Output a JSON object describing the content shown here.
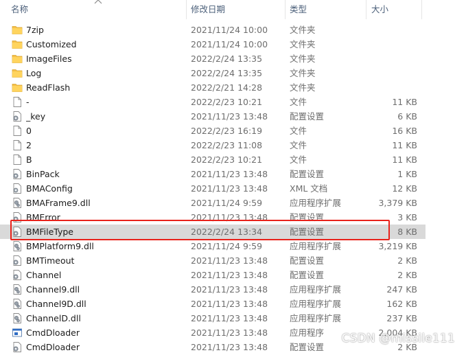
{
  "header": {
    "name": "名称",
    "date": "修改日期",
    "type": "类型",
    "size": "大小"
  },
  "files": [
    {
      "name": "7zip",
      "date": "2021/11/24 10:00",
      "type": "文件夹",
      "size": "",
      "icon": "folder-icon"
    },
    {
      "name": "Customized",
      "date": "2021/11/24 10:00",
      "type": "文件夹",
      "size": "",
      "icon": "folder-icon"
    },
    {
      "name": "ImageFiles",
      "date": "2022/2/24 13:35",
      "type": "文件夹",
      "size": "",
      "icon": "folder-icon"
    },
    {
      "name": "Log",
      "date": "2022/2/24 13:35",
      "type": "文件夹",
      "size": "",
      "icon": "folder-icon"
    },
    {
      "name": "ReadFlash",
      "date": "2022/2/21 14:28",
      "type": "文件夹",
      "size": "",
      "icon": "folder-icon"
    },
    {
      "name": "-",
      "date": "2022/2/23 10:21",
      "type": "文件",
      "size": "11 KB",
      "icon": "file-icon"
    },
    {
      "name": "_key",
      "date": "2021/11/23 13:48",
      "type": "配置设置",
      "size": "6 KB",
      "icon": "settings-file-icon"
    },
    {
      "name": "0",
      "date": "2022/2/23 16:19",
      "type": "文件",
      "size": "16 KB",
      "icon": "file-icon"
    },
    {
      "name": "2",
      "date": "2022/2/23 11:08",
      "type": "文件",
      "size": "11 KB",
      "icon": "file-icon"
    },
    {
      "name": "B",
      "date": "2022/2/23 10:21",
      "type": "文件",
      "size": "11 KB",
      "icon": "file-icon"
    },
    {
      "name": "BinPack",
      "date": "2021/11/23 13:48",
      "type": "配置设置",
      "size": "1 KB",
      "icon": "settings-file-icon"
    },
    {
      "name": "BMAConfig",
      "date": "2021/11/23 13:48",
      "type": "XML 文档",
      "size": "12 KB",
      "icon": "xml-file-icon"
    },
    {
      "name": "BMAFrame9.dll",
      "date": "2021/11/24 9:59",
      "type": "应用程序扩展",
      "size": "3,379 KB",
      "icon": "dll-file-icon"
    },
    {
      "name": "BMError",
      "date": "2021/11/23 13:48",
      "type": "配置设置",
      "size": "3 KB",
      "icon": "settings-file-icon"
    },
    {
      "name": "BMFileType",
      "date": "2022/2/24 13:34",
      "type": "配置设置",
      "size": "8 KB",
      "icon": "settings-file-icon"
    },
    {
      "name": "BMPlatform9.dll",
      "date": "2021/11/24 9:59",
      "type": "应用程序扩展",
      "size": "3,219 KB",
      "icon": "dll-file-icon"
    },
    {
      "name": "BMTimeout",
      "date": "2021/11/23 13:48",
      "type": "配置设置",
      "size": "2 KB",
      "icon": "settings-file-icon"
    },
    {
      "name": "Channel",
      "date": "2021/11/23 13:48",
      "type": "配置设置",
      "size": "2 KB",
      "icon": "settings-file-icon"
    },
    {
      "name": "Channel9.dll",
      "date": "2021/11/23 13:48",
      "type": "应用程序扩展",
      "size": "247 KB",
      "icon": "dll-file-icon"
    },
    {
      "name": "Channel9D.dll",
      "date": "2021/11/23 13:48",
      "type": "应用程序扩展",
      "size": "162 KB",
      "icon": "dll-file-icon"
    },
    {
      "name": "ChannelD.dll",
      "date": "2021/11/23 13:48",
      "type": "应用程序扩展",
      "size": "237 KB",
      "icon": "dll-file-icon"
    },
    {
      "name": "CmdDloader",
      "date": "2021/11/23 13:48",
      "type": "应用程序",
      "size": "2,004 KB",
      "icon": "exe-file-icon"
    },
    {
      "name": "CmdDloader",
      "date": "2021/11/23 13:48",
      "type": "配置设置",
      "size": "2 KB",
      "icon": "settings-file-icon"
    }
  ],
  "selected_index": 14,
  "watermark": "CSDN @missile111",
  "colors": {
    "selection": "#d9d9d9",
    "highlight_border": "#e8221b",
    "folder": "#f5c04a",
    "header_text": "#4c607a"
  }
}
